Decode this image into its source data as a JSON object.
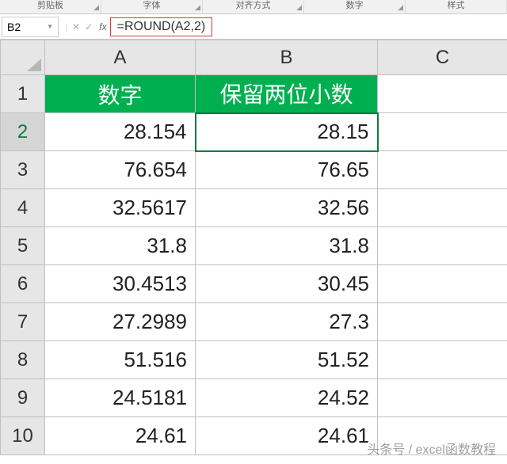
{
  "ribbon": {
    "groups": [
      "剪贴板",
      "字体",
      "对齐方式",
      "数字",
      "样式"
    ]
  },
  "nameBox": "B2",
  "formula": "=ROUND(A2,2)",
  "columns": [
    "A",
    "B",
    "C"
  ],
  "headers": {
    "A": "数字",
    "B": "保留两位小数"
  },
  "rows": [
    {
      "n": "1"
    },
    {
      "n": "2",
      "A": "28.154",
      "B": "28.15"
    },
    {
      "n": "3",
      "A": "76.654",
      "B": "76.65"
    },
    {
      "n": "4",
      "A": "32.5617",
      "B": "32.56"
    },
    {
      "n": "5",
      "A": "31.8",
      "B": "31.8"
    },
    {
      "n": "6",
      "A": "30.4513",
      "B": "30.45"
    },
    {
      "n": "7",
      "A": "27.2989",
      "B": "27.3"
    },
    {
      "n": "8",
      "A": "51.516",
      "B": "51.52"
    },
    {
      "n": "9",
      "A": "24.5181",
      "B": "24.52"
    },
    {
      "n": "10",
      "A": "24.61",
      "B": "24.61"
    }
  ],
  "activeCell": "B2",
  "watermark": "头条号 / excel函数教程"
}
